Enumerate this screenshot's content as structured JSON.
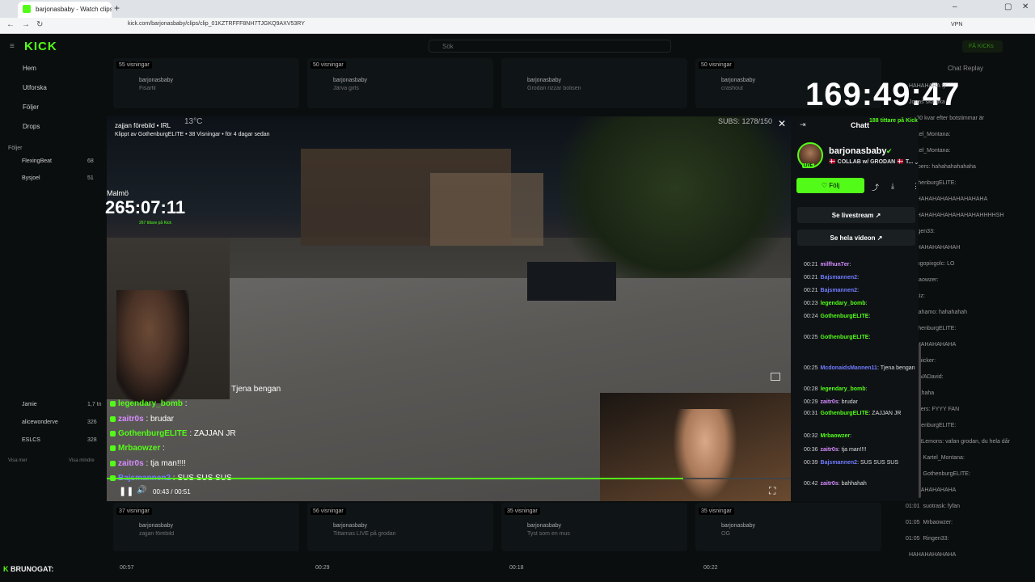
{
  "browser": {
    "tab_title": "barjonasbaby - Watch clips",
    "url": "kick.com/barjonasbaby/clips/clip_01KZTRFFF8NH7TJGKQ9AXV53RY",
    "vpn_label": "VPN",
    "kicks_label": "FÅ KICKs"
  },
  "sidebar": {
    "logo": "KICK",
    "nav": [
      "Hem",
      "Utforska",
      "Följer",
      "Drops"
    ],
    "following_header": "Följer",
    "following": [
      {
        "name": "FlexingBeat",
        "count": "68"
      },
      {
        "name": "Bysjoel",
        "count": "51"
      }
    ],
    "recommended": [
      {
        "name": "Jamie",
        "count": "1,7 tn"
      },
      {
        "name": "alicewonderve",
        "count": "326"
      },
      {
        "name": "ESLCS",
        "count": "328"
      }
    ],
    "show_more": "Visa mer",
    "show_less": "Visa mindre"
  },
  "search": {
    "placeholder": "Sök"
  },
  "background_cards": {
    "top": [
      {
        "views": "55 visningar",
        "channel": "barjonasbaby",
        "title": "Fisarfil",
        "meta": "för 6 dagar sedan",
        "tag": "Sover bara"
      },
      {
        "views": "50 visningar",
        "channel": "barjonasbaby",
        "title": "Järva girls",
        "meta": "för 2 dagar sedan",
        "tag": "IRL"
      },
      {
        "views": "",
        "channel": "barjonasbaby",
        "title": "Grodan rizzar bolisen",
        "meta": "för 3 dagar sedan",
        "tag": "IRL"
      },
      {
        "views": "50 visningar",
        "channel": "barjonasbaby",
        "title": "crashout",
        "meta": "för 5 dagar sedan",
        "tag": "IRL"
      }
    ],
    "bottom": [
      {
        "views": "37 visningar",
        "channel": "barjonasbaby",
        "title": "zajjan förebild",
        "meta": "för 4 dagar sedan",
        "tag": "IRL"
      },
      {
        "views": "56 visningar",
        "channel": "barjonasbaby",
        "title": "Tittarnas LIVE på grodan",
        "meta": "för 6 dagar sedan",
        "tag": "IRL"
      },
      {
        "views": "35 visningar",
        "channel": "barjonasbaby",
        "title": "Tyst som en mus",
        "meta": "för 1 dag sedan",
        "tag": "IRL"
      },
      {
        "views": "35 visningar",
        "channel": "barjonasbaby",
        "title": "OG",
        "meta": "för 2 dagar sedan",
        "tag": "IRL"
      }
    ],
    "thumb_times": [
      "00:57",
      "00:29",
      "00:18",
      "00:22"
    ]
  },
  "overlay_clock": "169:49:47",
  "chat_replay": {
    "title": "Chat Replay",
    "lines": [
      {
        "time": "",
        "text": "HAHAHAHA fy"
      },
      {
        "time": "",
        "text": "Jonas ska öka"
      },
      {
        "time": "",
        "text": "ca 90 kvar efter botstimmar är"
      },
      {
        "time": "",
        "text": "Kartel_Montana:"
      },
      {
        "time": "",
        "text": "Kartel_Montana:"
      },
      {
        "time": "",
        "text": "hjelpers: hahahahahahaha"
      },
      {
        "time": "",
        "text": "GothenburgELITE:"
      },
      {
        "time": "",
        "text": "HAHAHAHAHAHAHAHAHAHA"
      },
      {
        "time": "",
        "text": "HAHAHAHAHAHAHAHAHAHHHHSH"
      },
      {
        "time": "",
        "text": "Ringen33:"
      },
      {
        "time": "",
        "text": "HAHAHAHAHAHAH"
      },
      {
        "time": "",
        "text": "mangopixgolc: LO"
      },
      {
        "time": "",
        "text": "Mrbaowzer:"
      },
      {
        "time": "",
        "text": "hinkiz:"
      },
      {
        "time": "",
        "text": "nanahamo: hahahahah"
      },
      {
        "time": "",
        "text": "GothenburgELITE:"
      },
      {
        "time": "",
        "text": "HAHAHAHAHAHA"
      },
      {
        "time": "",
        "text": "picknicker:"
      },
      {
        "time": "",
        "text": "DAVVADavid:"
      },
      {
        "time": "",
        "text": "hahahaha"
      },
      {
        "time": "",
        "text": "hjelpers: FYYY FAN"
      },
      {
        "time": "",
        "text": "GothenburgELITE:"
      },
      {
        "time": "",
        "text": "NightLemons: vafan grodan, du hela dår"
      },
      {
        "time": "00:57",
        "text": "Kartel_Montana:"
      },
      {
        "time": "01:00",
        "text": "GothenburgELITE:"
      },
      {
        "time": "",
        "text": "HAHAHAHAHAHA"
      },
      {
        "time": "01:01",
        "text": "suotrask: fyfan"
      },
      {
        "time": "01:05",
        "text": "Mrbaowzer:"
      },
      {
        "time": "01:05",
        "text": "Ringen33:"
      },
      {
        "time": "",
        "text": "HAHAHAHAHAHA"
      }
    ]
  },
  "ticker": {
    "label": "BRUNOGAT:"
  },
  "clip": {
    "title": "zajjan förebild • IRL",
    "byline": "Klippt av GothenburgELITE • 38 Visningar • för 4 dagar sedan",
    "close_icon": "close-icon",
    "temperature": "13°C",
    "subs": "SUBS: 1278/150",
    "location": "Malmö",
    "stream_timer": "265:07:11",
    "stream_timer_sub": "267 tittare på Kick",
    "caption": "Tjena bengan",
    "overlay_chat": [
      {
        "user": "legendary_bomb",
        "sep": " : ",
        "text": "",
        "color": "#53fc18"
      },
      {
        "user": "zaitr0s",
        "sep": " : ",
        "text": "brudar",
        "color": "#d58cff"
      },
      {
        "user": "GothenburgELITE",
        "sep": " : ",
        "text": "ZAJJAN JR",
        "color": "#53fc18"
      },
      {
        "user": "Mrbaowzer",
        "sep": " : ",
        "text": "",
        "color": "#53fc18"
      },
      {
        "user": "zaitr0s",
        "sep": " : ",
        "text": "tja man!!!!",
        "color": "#d58cff"
      },
      {
        "user": "Bajsmannen2",
        "sep": " : ",
        "text": "SUS SUS SUS",
        "color": "#6f7cff"
      }
    ],
    "current_time": "00:43 / 00:51",
    "progress": 0.843
  },
  "panel": {
    "chat_label": "Chatt",
    "viewers": "188 tittare på Kick",
    "channel_name": "barjonasbaby",
    "live_badge": "LIVE",
    "stream_title": "🇩🇰 COLLAB w/ GRODAN 🇩🇰 T...",
    "follow_label": "Följ",
    "livestream_link": "Se livestream",
    "full_video_link": "Se hela videon",
    "chat": [
      {
        "t": "00:21",
        "u": "milfhun7er",
        "m": ":",
        "c": "#d58cff"
      },
      {
        "t": "00:21",
        "u": "Bajsmannen2",
        "m": ":",
        "c": "#6f7cff"
      },
      {
        "t": "00:21",
        "u": "Bajsmannen2",
        "m": ":",
        "c": "#6f7cff"
      },
      {
        "t": "00:23",
        "u": "legendary_bomb",
        "m": ":",
        "c": "#53fc18"
      },
      {
        "t": "00:24",
        "u": "GothenburgELITE",
        "m": ":",
        "c": "#53fc18"
      },
      {
        "t": "00:25",
        "u": "GothenburgELITE",
        "m": ":",
        "c": "#53fc18"
      },
      {
        "t": "00:25",
        "u": "McdonaidsMannen11",
        "m": ": Tjena bengan",
        "c": "#6f7cff"
      },
      {
        "t": "00:28",
        "u": "legendary_bomb",
        "m": ":",
        "c": "#53fc18"
      },
      {
        "t": "00:29",
        "u": "zaitr0s",
        "m": ": brudar",
        "c": "#d58cff"
      },
      {
        "t": "00:31",
        "u": "GothenburgELITE",
        "m": ": ZAJJAN JR",
        "c": "#53fc18"
      },
      {
        "t": "00:32",
        "u": "Mrbaowzer",
        "m": ":",
        "c": "#53fc18"
      },
      {
        "t": "00:36",
        "u": "zaitr0s",
        "m": ": tja man!!!!",
        "c": "#d58cff"
      },
      {
        "t": "00:39",
        "u": "Bajsmannen2",
        "m": ": SUS SUS SUS",
        "c": "#6f7cff"
      },
      {
        "t": "00:42",
        "u": "zaitr0s",
        "m": ": bahhahah",
        "c": "#d58cff"
      }
    ]
  },
  "colors": {
    "accent": "#53fc18",
    "background": "#0b0e0f"
  }
}
